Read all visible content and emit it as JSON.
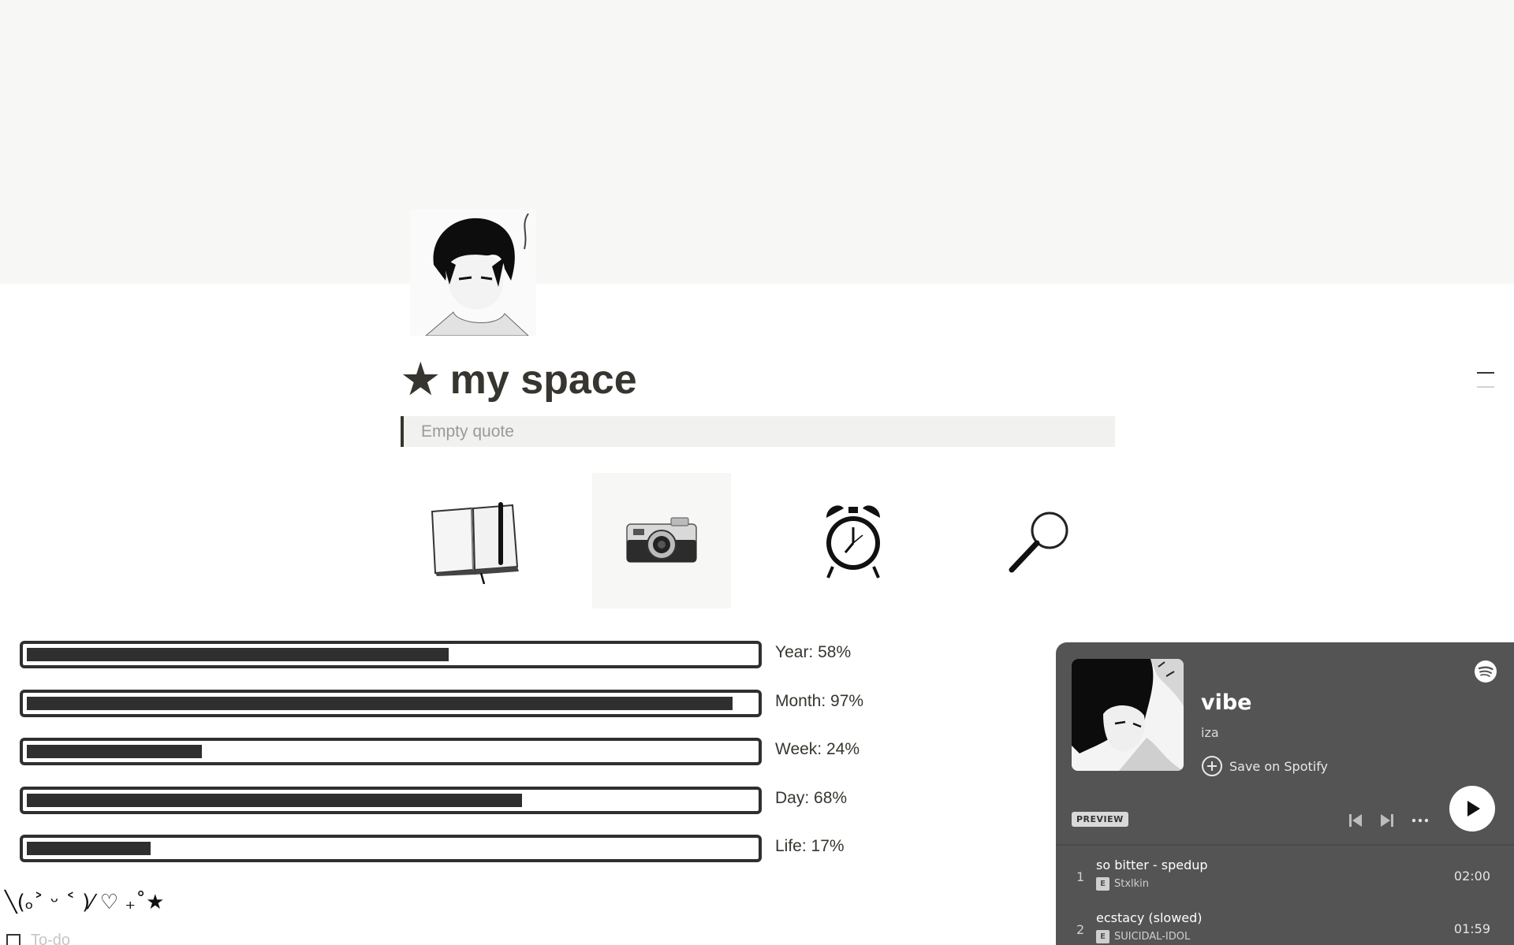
{
  "page": {
    "title_icon": "★",
    "title": "my space",
    "page_icon": "manga-portrait-icon",
    "quote_placeholder": "Empty quote"
  },
  "nav_icons": [
    {
      "name": "notebook-icon"
    },
    {
      "name": "camera-icon"
    },
    {
      "name": "alarm-clock-icon"
    },
    {
      "name": "magnifier-icon"
    }
  ],
  "progress": [
    {
      "label": "Year: 58%",
      "value": 0.58
    },
    {
      "label": "Month: 97%",
      "value": 0.97
    },
    {
      "label": "Week: 24%",
      "value": 0.24
    },
    {
      "label": "Day: 68%",
      "value": 0.68
    },
    {
      "label": "Life: 17%",
      "value": 0.17
    }
  ],
  "kaomoji": "╲(ₒ˃ ᵕ ˂ )⁄ ♡ ₊˚★",
  "todo": {
    "placeholder": "To-do"
  },
  "spotify": {
    "title": "vibe",
    "artist": "iza",
    "save_label": "Save on Spotify",
    "preview_label": "PREVIEW",
    "tracks": [
      {
        "num": "1",
        "name": "so bitter - spedup",
        "artist": "Stxlkin",
        "explicit": "E",
        "duration": "02:00"
      },
      {
        "num": "2",
        "name": "ecstacy (slowed)",
        "artist": "SUICIDAL-IDOL",
        "explicit": "E",
        "duration": "01:59"
      }
    ]
  },
  "colors": {
    "cover": "#f7f7f5",
    "text": "#37352f",
    "bar": "#2f2f2f",
    "spotify_bg": "#545454"
  }
}
